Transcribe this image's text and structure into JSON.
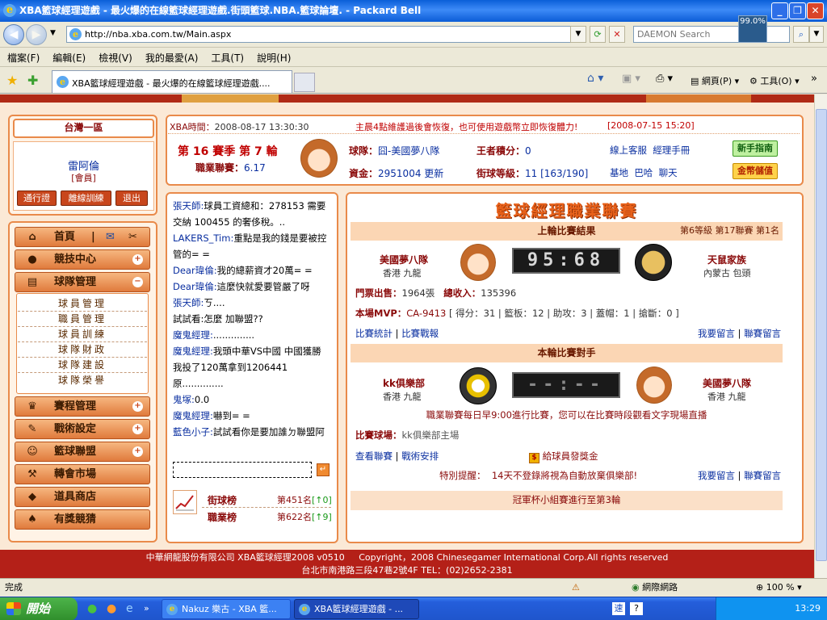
{
  "window": {
    "title": "XBA籃球經理遊戲 - 最火爆的在線籃球經理遊戲.街頭籃球.NBA.籃球論壇. - Packard Bell"
  },
  "address": {
    "url": "http://nba.xba.com.tw/Main.aspx",
    "search_placeholder": "DAEMON Search",
    "meter": "99.0%"
  },
  "menu": [
    "檔案(F)",
    "編輯(E)",
    "檢視(V)",
    "我的最愛(A)",
    "工具(T)",
    "說明(H)"
  ],
  "tab": {
    "title": "XBA籃球經理遊戲 - 最火爆的在線籃球經理遊戲...."
  },
  "commands": {
    "page": "網頁(P)",
    "tools": "工具(O)"
  },
  "region": "台灣一區",
  "user": {
    "name": "雷阿倫",
    "role": "[會員]"
  },
  "userButtons": [
    "通行證",
    "離線訓練",
    "退出"
  ],
  "nav": {
    "home": "首頁",
    "competition": "競技中心",
    "team": "球隊管理",
    "teamSub": [
      "球員管理",
      "職員管理",
      "球員訓練",
      "球隊財政",
      "球隊建設",
      "球隊榮譽"
    ],
    "schedule": "賽程管理",
    "tactics": "戰術設定",
    "league": "籃球聯盟",
    "transfer": "轉會市場",
    "shop": "道具商店",
    "prize": "有獎競猜"
  },
  "top": {
    "time_label": "XBA時間：",
    "time": "2008-08-17 13:30:30",
    "notice": "主晨4點維護過後會恢復，也可使用遊戲幣立即恢復體力!",
    "notice_date": "[2008-07-15 15:20]",
    "season": "第 16 賽季 第 7 輪",
    "career_label": "職業聯賽：",
    "career": "6.17",
    "team_label": "球隊：",
    "team": "囧-美國夢八隊",
    "king_label": "王者積分：",
    "king": "0",
    "cash_label": "資金：",
    "cash": "2951004",
    "refresh": "更新",
    "level_label": "街球等級：",
    "level": "11 [163/190]",
    "links1": [
      "線上客服",
      "經理手冊"
    ],
    "links2": [
      "基地",
      "巴哈",
      "聊天"
    ],
    "guide_btn": "新手指南",
    "coin_btn": "金幣儲值"
  },
  "chat": [
    {
      "name": "張天師:",
      "text": "球員工資總和：278153 需要交納 100455 的奢侈稅。.."
    },
    {
      "name": "LAKERS_Tim:",
      "text": "重點是我的錢是要被控管的= ="
    },
    {
      "name": "Dear瑋倫:",
      "text": "我的總薪資才20萬= ="
    },
    {
      "name": "Dear瑋倫:",
      "text": "這麼快就愛要管嚴了呀"
    },
    {
      "name": "張天師:",
      "text": "ㄎ...."
    },
    {
      "name": "",
      "text": "試試看:怎麼 加聯盟??"
    },
    {
      "name": "魔鬼經理:",
      "text": ".............."
    },
    {
      "name": "魔鬼經理:",
      "text": "我頭中華VS中國 中國獲勝 我投了120萬拿到1206441 原.............."
    },
    {
      "name": "鬼塚:",
      "text": "0.0"
    },
    {
      "name": "魔鬼經理:",
      "text": "嚇到= ="
    },
    {
      "name": "藍色小子:",
      "text": "試試看你是要加誰ㄉ聯盟阿"
    }
  ],
  "rank": {
    "street_label": "街球榜",
    "street_rank": "第451名",
    "street_change": "[↑0]",
    "career_label": "職業榜",
    "career_rank": "第622名",
    "career_change": "[↑9]"
  },
  "league": {
    "title": "籃球經理職業聯賽",
    "last_header": "上輪比賽結果",
    "division": "第6等級 第17聯賽 第1名",
    "home_team": "美國夢八隊",
    "home_loc": "香港 九龍",
    "score": "95:68",
    "away_team": "天鼠家族",
    "away_loc": "內蒙古 包頭",
    "tickets_label": "門票出售：",
    "tickets": "1964張",
    "income_label": "總收入：",
    "income": "135396",
    "mvp_label": "本場MVP：",
    "mvp": "CA-9413",
    "mvp_stats": "[ 得分：31 | 籃板：12 | 助攻：3 | 蓋帽：1 | 搶斷：0 ]",
    "link_stats": "比賽統計",
    "link_report": "比賽戰報",
    "link_msg": "我要留言",
    "link_league_msg": "聯賽留言",
    "next_header": "本輪比賽對手",
    "next_home": "kk俱樂部",
    "next_home_loc": "香港 九龍",
    "next_score": "--:--",
    "next_away": "美國夢八隊",
    "next_away_loc": "香港 九龍",
    "note": "職業聯賽每日早9:00進行比賽，您可以在比賽時段觀看文字現場直播",
    "venue_label": "比賽球場：",
    "venue": "kk俱樂部主場",
    "link_view": "查看聯賽",
    "link_tactics": "戰術安排",
    "bonus": "給球員發獎金",
    "warn_label": "特別提醒：",
    "warn": "14天不登錄將視為自動放棄俱樂部!",
    "link_msg2": "我要留言",
    "link_league_msg2": "聯賽留言",
    "cup": "冠軍杯小組賽進行至第3輪"
  },
  "footer": {
    "line1": "中華網龍股份有限公司 XBA籃球經理2008 v0510     Copyright，2008 Chinesegamer International Corp.All rights reserved",
    "line2": "台北市南港路三段47巷2號4F TEL：(02)2652-2381"
  },
  "status": {
    "text": "完成",
    "zone": "網際網路",
    "zoom": "100 %"
  },
  "taskbar": {
    "start": "開始",
    "items": [
      "Nakuz 樂古 - XBA 籃...",
      "XBA籃球經理遊戲 - ..."
    ],
    "clock": "13:29"
  },
  "colors": {
    "accent": "#e98a4a",
    "banner": "#b42018",
    "link": "#0a2fa0"
  }
}
